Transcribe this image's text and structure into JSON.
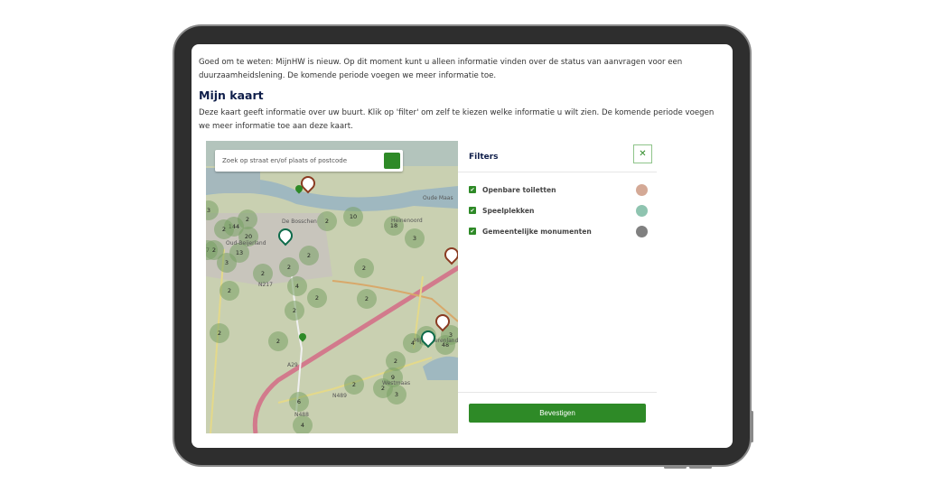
{
  "intro_text": "Goed om te weten: MijnHW is nieuw. Op dit moment kunt u alleen informatie vinden over de status van aanvragen voor een duurzaamheidslening. De komende periode voegen we meer informatie toe.",
  "map_section": {
    "title": "Mijn kaart",
    "description": "Deze kaart geeft informatie over uw buurt. Klik op 'filter' om zelf te kiezen welke informatie u wilt zien. De komende periode voegen we meer informatie toe aan deze kaart."
  },
  "map": {
    "search_placeholder": "Zoek op straat en/of plaats of postcode",
    "search_icon": "search-icon",
    "labels": [
      "Oud-Beijerland",
      "De Bosschen",
      "Oude Maas",
      "Heinenoord",
      "Westmaas",
      "Mijnsheerenland",
      "A29",
      "N217",
      "N489",
      "N488"
    ],
    "clusters": [
      "3",
      "144",
      "2",
      "2",
      "20",
      "7",
      "2",
      "13",
      "3",
      "2",
      "2",
      "2",
      "2",
      "10",
      "18",
      "3",
      "2",
      "2",
      "4",
      "2",
      "2",
      "2",
      "2",
      "2",
      "2",
      "6",
      "4",
      "2",
      "9",
      "2",
      "3",
      "4",
      "6",
      "48",
      "3"
    ]
  },
  "filters": {
    "title": "Filters",
    "close_icon": "close-icon",
    "items": [
      {
        "label": "Openbare toiletten",
        "checked": true,
        "color": "#d4a996"
      },
      {
        "label": "Speelplekken",
        "checked": true,
        "color": "#8fc4b0"
      },
      {
        "label": "Gemeentelijke monumenten",
        "checked": true,
        "color": "#808080"
      }
    ],
    "confirm_label": "Bevestigen"
  },
  "colors": {
    "accent": "#2e8a27",
    "heading": "#0f1e4a"
  }
}
